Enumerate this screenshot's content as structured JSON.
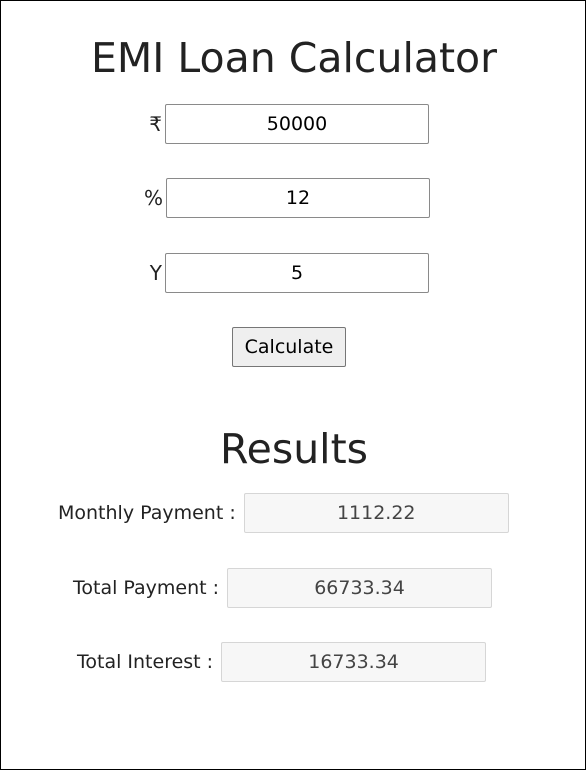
{
  "page": {
    "title": "EMI Loan Calculator"
  },
  "inputs": {
    "principal": {
      "symbol": "₹",
      "value": "50000"
    },
    "rate": {
      "symbol": "%",
      "value": "12"
    },
    "years": {
      "symbol": "Y",
      "value": "5"
    }
  },
  "actions": {
    "calculate_label": "Calculate"
  },
  "results": {
    "title": "Results",
    "monthly_payment": {
      "label": "Monthly Payment :",
      "value": "1112.22"
    },
    "total_payment": {
      "label": "Total Payment :",
      "value": "66733.34"
    },
    "total_interest": {
      "label": "Total Interest :",
      "value": "16733.34"
    }
  }
}
